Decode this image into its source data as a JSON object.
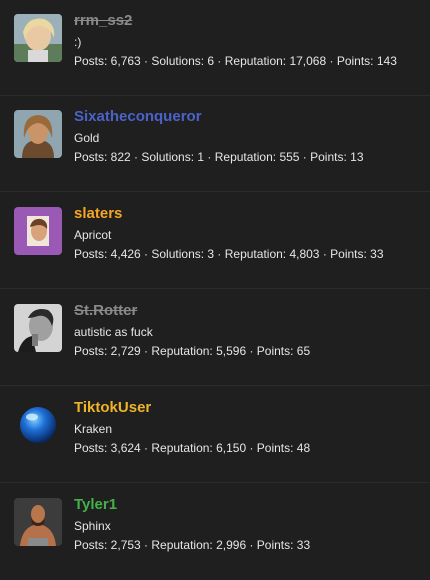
{
  "members": [
    {
      "username": "rrm_ss2",
      "username_color": "#8a8a8a",
      "banned": true,
      "title": ":)",
      "stats": "Posts: 6,763 · Solutions: 6 · Reputation: 17,068 · Points: 143",
      "avatar": "photo-blonde-child"
    },
    {
      "username": "Sixatheconqueror",
      "username_color": "#4b63c9",
      "banned": false,
      "title": "Gold",
      "stats": "Posts: 822 · Solutions: 1 · Reputation: 555 · Points: 13",
      "avatar": "photo-long-hair-man"
    },
    {
      "username": "slaters",
      "username_color": "#f5a623",
      "banned": false,
      "title": "Apricot",
      "stats": "Posts: 4,426 · Solutions: 3 · Reputation: 4,803 · Points: 33",
      "avatar": "photo-purple-background-man"
    },
    {
      "username": "St.Rotter",
      "username_color": "#8a8a8a",
      "banned": true,
      "title": "autistic as fuck",
      "stats": "Posts: 2,729 · Reputation: 5,596 · Points: 65",
      "avatar": "photo-bw-smoker"
    },
    {
      "username": "TiktokUser",
      "username_color": "#f0b428",
      "banned": false,
      "title": "Kraken",
      "stats": "Posts: 3,624 · Reputation: 6,150 · Points: 48",
      "avatar": "blue-orb"
    },
    {
      "username": "Tyler1",
      "username_color": "#43b04a",
      "banned": false,
      "title": "Sphinx",
      "stats": "Posts: 2,753 · Reputation: 2,996 · Points: 33",
      "avatar": "photo-muscular-man"
    }
  ]
}
